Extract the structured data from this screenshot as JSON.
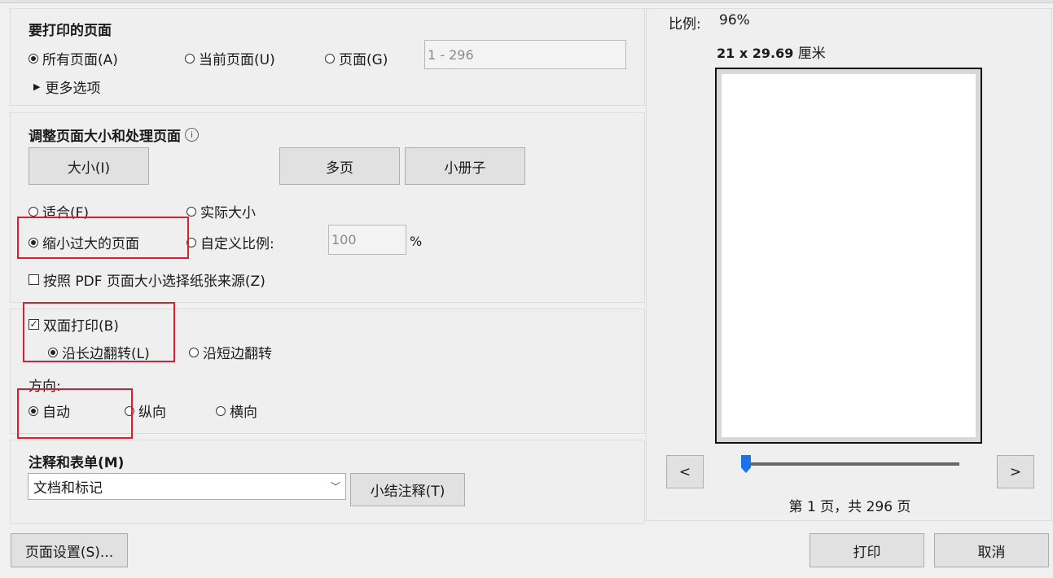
{
  "pages_section": {
    "title": "要打印的页面",
    "all_pages": "所有页面(A)",
    "current_page": "当前页面(U)",
    "pages": "页面(G)",
    "pages_range": "1 - 296",
    "more_options": "更多选项"
  },
  "resize_section": {
    "title": "调整页面大小和处理页面",
    "size_button": "大小(I)",
    "multiple_button": "多页",
    "booklet_button": "小册子",
    "fit": "适合(F)",
    "actual_size": "实际大小",
    "shrink_oversized": "缩小过大的页面",
    "custom_scale": "自定义比例:",
    "custom_scale_value": "100",
    "percent_sign": "%",
    "paper_source": "按照 PDF 页面大小选择纸张来源(Z)"
  },
  "duplex_section": {
    "duplex": "双面打印(B)",
    "duplex_check": "✓",
    "long_edge": "沿长边翻转(L)",
    "short_edge": "沿短边翻转",
    "orientation_label": "方向:",
    "auto": "自动",
    "portrait": "纵向",
    "landscape": "横向"
  },
  "comments_section": {
    "title": "注释和表单(M)",
    "selected": "文档和标记",
    "summarize_button": "小结注释(T)"
  },
  "preview": {
    "scale_label": "比例:",
    "scale_value": "96%",
    "paper_dims": "21 x 29.69",
    "paper_unit": "厘米",
    "prev": "<",
    "next": ">",
    "page_info": "第 1 页，共 296 页",
    "slider_position": 0
  },
  "footer": {
    "page_setup": "页面设置(S)...",
    "print": "打印",
    "cancel": "取消"
  },
  "colors": {
    "highlight_box": "#e01e2b",
    "slider_thumb": "#1a73e8"
  }
}
